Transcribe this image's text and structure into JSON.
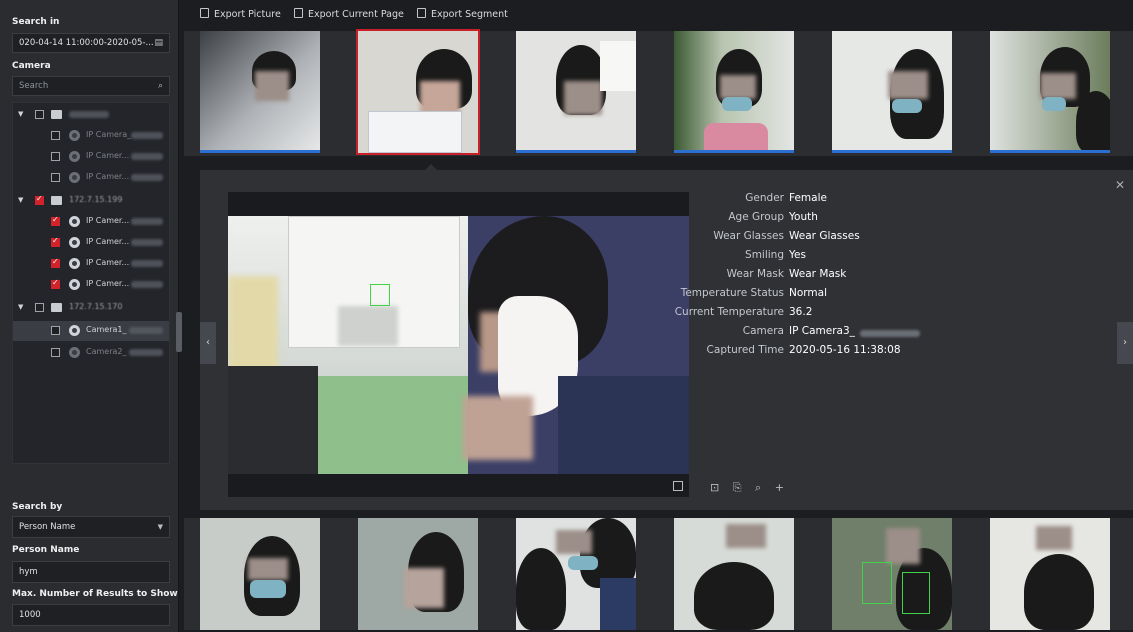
{
  "left": {
    "search_in_title": "Search in",
    "time_range": "020-04-14 11:00:00-2020-05-...",
    "camera_title": "Camera",
    "camera_search_placeholder": "Search",
    "tree": [
      {
        "type": "group",
        "label": "",
        "checked": false
      },
      {
        "type": "camera",
        "label": "IP Camera_",
        "checked": false,
        "dim": true
      },
      {
        "type": "camera",
        "label": "IP Camer...",
        "checked": false,
        "dim": true
      },
      {
        "type": "camera",
        "label": "IP Camer...",
        "checked": false,
        "dim": true
      },
      {
        "type": "group",
        "label": "172.7.15.199",
        "checked": true
      },
      {
        "type": "camera",
        "label": "IP Camer...",
        "checked": true,
        "dim": false
      },
      {
        "type": "camera",
        "label": "IP Camer...",
        "checked": true,
        "dim": false
      },
      {
        "type": "camera",
        "label": "IP Camer...",
        "checked": true,
        "dim": false
      },
      {
        "type": "camera",
        "label": "IP Camer...",
        "checked": true,
        "dim": false
      },
      {
        "type": "group",
        "label": "172.7.15.170",
        "checked": false
      },
      {
        "type": "camera",
        "label": "Camera1_",
        "checked": false,
        "dim": false,
        "selected": true
      },
      {
        "type": "camera",
        "label": "Camera2_",
        "checked": false,
        "dim": true
      }
    ],
    "search_by_title": "Search by",
    "search_by_value": "Person Name",
    "person_name_title": "Person Name",
    "person_name_value": "hym",
    "max_results_title": "Max. Number of Results to Show",
    "max_results_value": "1000"
  },
  "toolbar": {
    "export_picture": "Export Picture",
    "export_current_page": "Export Current Page",
    "export_segment": "Export Segment"
  },
  "details": [
    {
      "key": "Gender",
      "value": "Female"
    },
    {
      "key": "Age Group",
      "value": "Youth"
    },
    {
      "key": "Wear Glasses",
      "value": "Wear Glasses"
    },
    {
      "key": "Smiling",
      "value": "Yes"
    },
    {
      "key": "Wear Mask",
      "value": "Wear Mask"
    },
    {
      "key": "Temperature Status",
      "value": "Normal"
    },
    {
      "key": "Current Temperature",
      "value": "36.2"
    },
    {
      "key": "Camera",
      "value": "IP Camera3_"
    },
    {
      "key": "Captured Time",
      "value": "2020-05-16 11:38:08"
    }
  ],
  "colors": {
    "accent_blue": "#2a6fd1",
    "selected_red": "#c8202a",
    "checkbox_red": "#d2232a"
  }
}
